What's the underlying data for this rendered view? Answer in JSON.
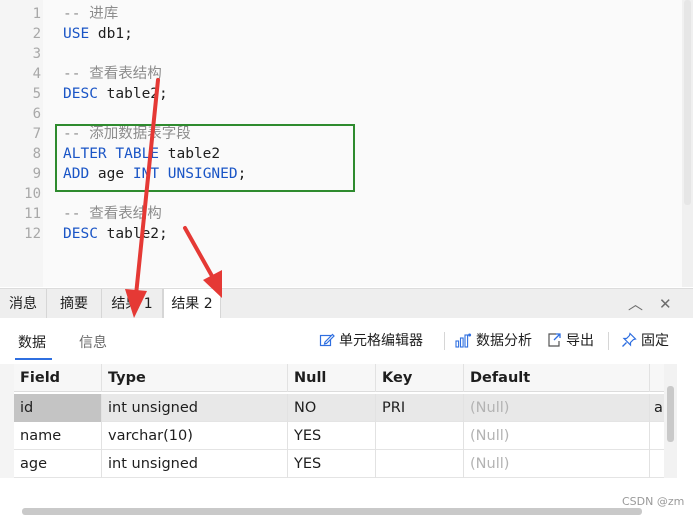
{
  "editor": {
    "lines": [
      {
        "n": "1",
        "tokens": [
          {
            "t": "-- 进库",
            "c": "cmt"
          }
        ]
      },
      {
        "n": "2",
        "tokens": [
          {
            "t": "USE",
            "c": "kw"
          },
          {
            "t": " db1;",
            "c": "id"
          }
        ]
      },
      {
        "n": "3",
        "tokens": []
      },
      {
        "n": "4",
        "tokens": [
          {
            "t": "-- 查看表结构",
            "c": "cmt"
          }
        ]
      },
      {
        "n": "5",
        "tokens": [
          {
            "t": "DESC",
            "c": "kw"
          },
          {
            "t": " table2;",
            "c": "id"
          }
        ]
      },
      {
        "n": "6",
        "tokens": []
      },
      {
        "n": "7",
        "tokens": [
          {
            "t": "-- 添加数据表字段",
            "c": "cmt"
          }
        ]
      },
      {
        "n": "8",
        "tokens": [
          {
            "t": "ALTER TABLE",
            "c": "kw"
          },
          {
            "t": " table2",
            "c": "id"
          }
        ]
      },
      {
        "n": "9",
        "tokens": [
          {
            "t": "ADD",
            "c": "kw"
          },
          {
            "t": " age ",
            "c": "id"
          },
          {
            "t": "INT UNSIGNED",
            "c": "kw"
          },
          {
            "t": ";",
            "c": "id"
          }
        ]
      },
      {
        "n": "10",
        "tokens": []
      },
      {
        "n": "11",
        "tokens": [
          {
            "t": "-- 查看表结构",
            "c": "cmt"
          }
        ]
      },
      {
        "n": "12",
        "tokens": [
          {
            "t": "DESC",
            "c": "kw"
          },
          {
            "t": " table2;",
            "c": "id"
          }
        ]
      }
    ]
  },
  "tabs": {
    "items": [
      {
        "label": "消息"
      },
      {
        "label": "摘要"
      },
      {
        "label": "结果 1"
      },
      {
        "label": "结果 2"
      }
    ],
    "active": "结果 2",
    "collapse_glyph": "︿",
    "close_glyph": "✕"
  },
  "subtabs": {
    "data_label": "数据",
    "info_label": "信息"
  },
  "toolbar": {
    "cell_editor": "单元格编辑器",
    "data_analysis": "数据分析",
    "export": "导出",
    "pin": "固定"
  },
  "grid": {
    "columns": [
      "Field",
      "Type",
      "Null",
      "Key",
      "Default"
    ],
    "rows": [
      {
        "field": "id",
        "type": "int unsigned",
        "null": "NO",
        "key": "PRI",
        "default": "(Null)",
        "extra": "a"
      },
      {
        "field": "name",
        "type": "varchar(10)",
        "null": "YES",
        "key": "",
        "default": "(Null)",
        "extra": ""
      },
      {
        "field": "age",
        "type": "int unsigned",
        "null": "YES",
        "key": "",
        "default": "(Null)",
        "extra": ""
      }
    ]
  },
  "watermark": "CSDN @zm",
  "colors": {
    "keyword": "#1a55c6",
    "comment": "#8c8c8c",
    "highlight_box": "#2e8b2e",
    "arrow": "#e53935",
    "accent": "#2f6fe0"
  }
}
